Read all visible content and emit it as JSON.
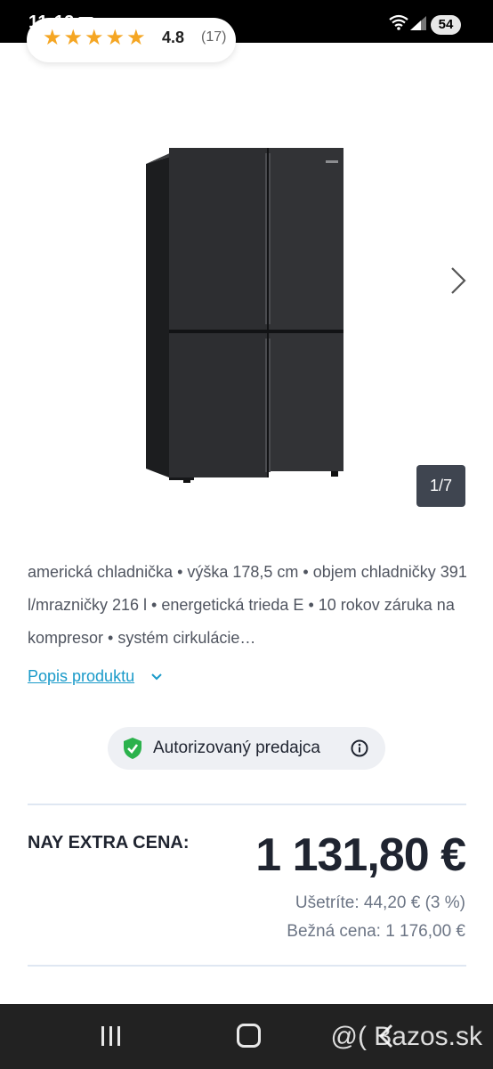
{
  "status_bar": {
    "time": "11:12",
    "battery": "54"
  },
  "rating": {
    "stars": "★★★★★",
    "value": "4.8",
    "count": "(17)"
  },
  "gallery": {
    "counter": "1/7"
  },
  "description": {
    "text": "americká chladnička • výška 178,5 cm • objem chladničky 391 l/mrazničky 216 l • energetická trieda E • 10 rokov záruka na kompresor • systém cirkulácie…",
    "link_label": "Popis produktu"
  },
  "seller": {
    "label": "Autorizovaný predajca"
  },
  "price": {
    "label": "NAY EXTRA CENA:",
    "value": "1 131,80 €",
    "savings": "Ušetríte: 44,20 € (3 %)",
    "regular": "Bežná cena: 1 176,00 €"
  },
  "watermark": "@( Bazos.sk",
  "colors": {
    "link": "#1a9ac9",
    "star": "#f5a623",
    "check_shield": "#2bb24c",
    "counter_bg": "#3f4550"
  },
  "icons": {
    "calendar": "calendar-icon",
    "wifi": "wifi-icon",
    "signal": "signal-icon",
    "next": "chevron-right-icon",
    "dropdown": "chevron-down-icon",
    "shield": "shield-check-icon",
    "info": "info-icon",
    "recent": "recent-apps-icon",
    "home": "home-icon",
    "back": "back-icon"
  }
}
